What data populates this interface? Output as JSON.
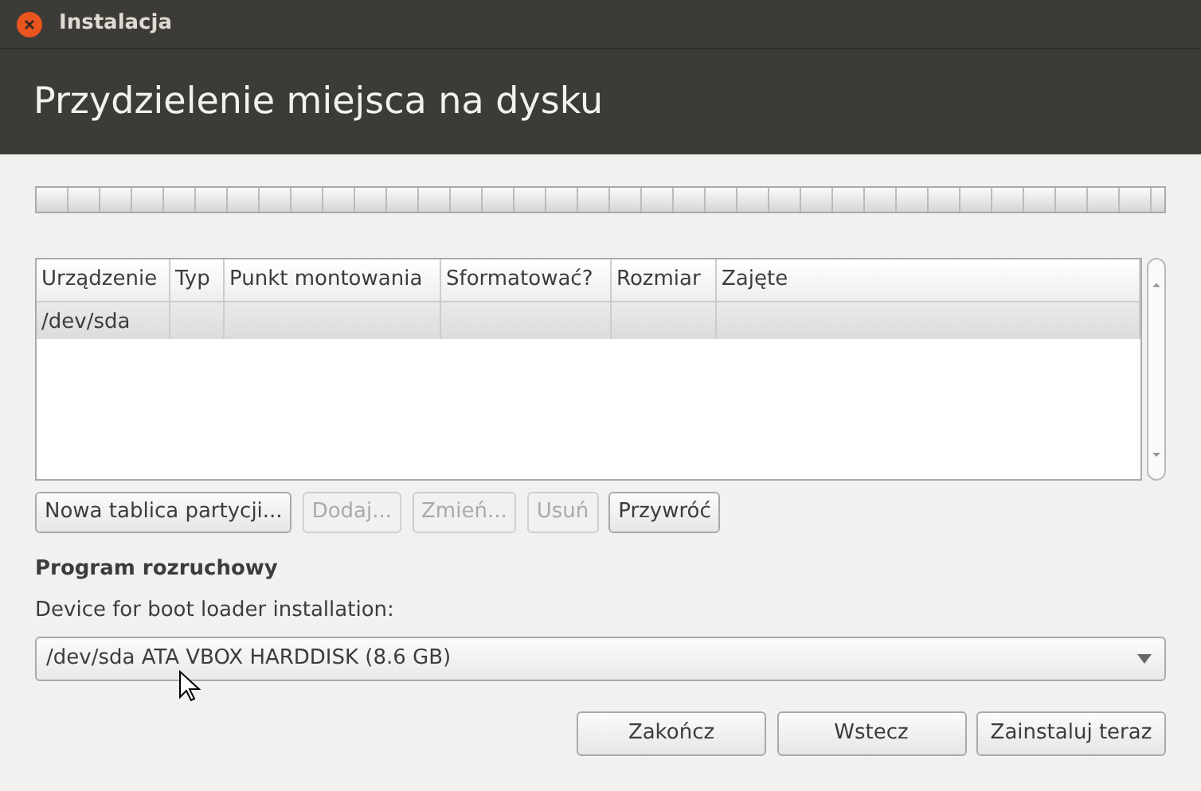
{
  "window": {
    "title": "Instalacja"
  },
  "header": {
    "title": "Przydzielenie miejsca na dysku"
  },
  "table": {
    "columns": [
      "Urządzenie",
      "Typ",
      "Punkt montowania",
      "Sformatować?",
      "Rozmiar",
      "Zajęte"
    ],
    "rows": [
      {
        "cells": [
          "/dev/sda",
          "",
          "",
          "",
          "",
          ""
        ],
        "selected": true
      }
    ]
  },
  "partition_buttons": [
    {
      "label": "Nowa tablica partycji...",
      "disabled": false
    },
    {
      "label": "Dodaj...",
      "disabled": true
    },
    {
      "label": "Zmień...",
      "disabled": true
    },
    {
      "label": "Usuń",
      "disabled": true
    },
    {
      "label": "Przywróć",
      "disabled": false
    }
  ],
  "bootloader": {
    "heading": "Program rozruchowy",
    "label": "Device for boot loader installation:",
    "value": "/dev/sda ATA VBOX HARDDISK (8.6 GB)"
  },
  "buttons": [
    {
      "label": "Zakończ"
    },
    {
      "label": "Wstecz"
    },
    {
      "label": "Zainstaluj teraz"
    }
  ]
}
